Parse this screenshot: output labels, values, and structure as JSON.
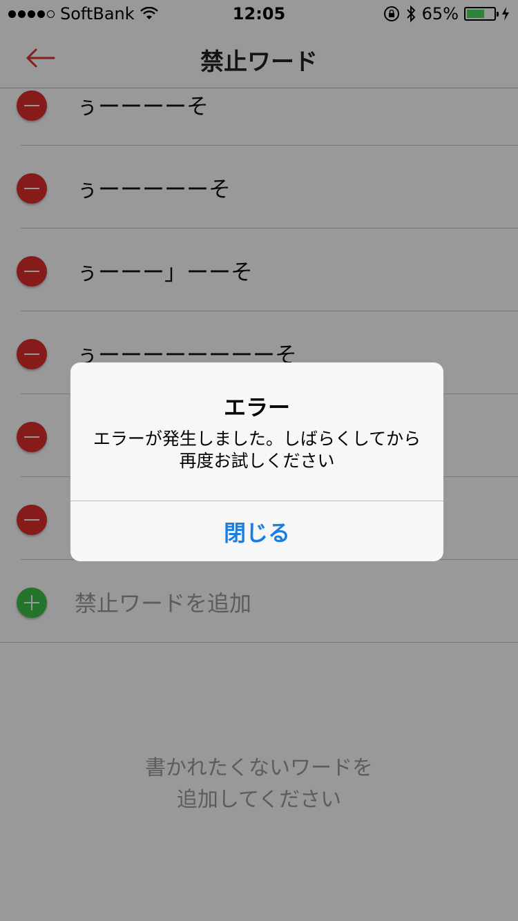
{
  "status_bar": {
    "carrier": "SoftBank",
    "time": "12:05",
    "battery_percent": "65%",
    "battery_level": 0.65,
    "signal_bars_filled": 4,
    "signal_bars_total": 5
  },
  "nav": {
    "title": "禁止ワード",
    "back_icon": "back-arrow-icon"
  },
  "words": [
    {
      "text": "ぅーーーーそ"
    },
    {
      "text": "ぅーーーーーそ"
    },
    {
      "text": "ぅーーー」ーーそ"
    },
    {
      "text": "ぅーーーーーーーーそ"
    },
    {
      "text": ""
    },
    {
      "text": ""
    }
  ],
  "add_row": {
    "label": "禁止ワードを追加"
  },
  "hint": {
    "line1": "書かれたくないワードを",
    "line2": "追加してください"
  },
  "alert": {
    "title": "エラー",
    "message": "エラーが発生しました。しばらくしてから再度お試しください",
    "button_label": "閉じる"
  },
  "colors": {
    "accent_red": "#e02d2d",
    "add_green": "#3cc349",
    "alert_button_blue": "#1a7fe0"
  }
}
